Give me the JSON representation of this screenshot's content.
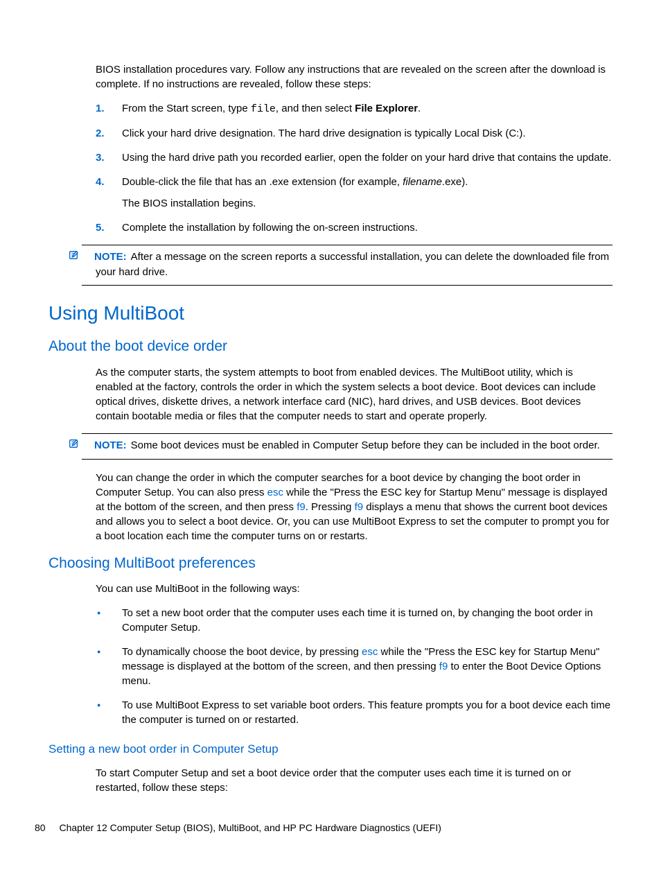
{
  "intro": "BIOS installation procedures vary. Follow any instructions that are revealed on the screen after the download is complete. If no instructions are revealed, follow these steps:",
  "steps": {
    "s1": {
      "num": "1.",
      "pre": "From the Start screen, type ",
      "code": "file",
      "mid": ", and then select ",
      "bold": "File Explorer",
      "post": "."
    },
    "s2": {
      "num": "2.",
      "text": "Click your hard drive designation. The hard drive designation is typically Local Disk (C:)."
    },
    "s3": {
      "num": "3.",
      "text": "Using the hard drive path you recorded earlier, open the folder on your hard drive that contains the update."
    },
    "s4": {
      "num": "4.",
      "pre": "Double-click the file that has an .exe extension (for example, ",
      "italic": "filename",
      "post": ".exe).",
      "sub": "The BIOS installation begins."
    },
    "s5": {
      "num": "5.",
      "text": "Complete the installation by following the on-screen instructions."
    }
  },
  "note1": {
    "label": "NOTE:",
    "text": "After a message on the screen reports a successful installation, you can delete the downloaded file from your hard drive."
  },
  "h1": "Using MultiBoot",
  "h2a": "About the boot device order",
  "para_about": "As the computer starts, the system attempts to boot from enabled devices. The MultiBoot utility, which is enabled at the factory, controls the order in which the system selects a boot device. Boot devices can include optical drives, diskette drives, a network interface card (NIC), hard drives, and USB devices. Boot devices contain bootable media or files that the computer needs to start and operate properly.",
  "note2": {
    "label": "NOTE:",
    "text": "Some boot devices must be enabled in Computer Setup before they can be included in the boot order."
  },
  "para_change": {
    "p1": "You can change the order in which the computer searches for a boot device by changing the boot order in Computer Setup. You can also press ",
    "k1": "esc",
    "p2": " while the \"Press the ESC key for Startup Menu\" message is displayed at the bottom of the screen, and then press ",
    "k2": "f9",
    "p3": ". Pressing ",
    "k3": "f9",
    "p4": " displays a menu that shows the current boot devices and allows you to select a boot device. Or, you can use MultiBoot Express to set the computer to prompt you for a boot location each time the computer turns on or restarts."
  },
  "h2b": "Choosing MultiBoot preferences",
  "para_prefs": "You can use MultiBoot in the following ways:",
  "bullets": {
    "b1": "To set a new boot order that the computer uses each time it is turned on, by changing the boot order in Computer Setup.",
    "b2": {
      "p1": "To dynamically choose the boot device, by pressing ",
      "k1": "esc",
      "p2": " while the \"Press the ESC key for Startup Menu\" message is displayed at the bottom of the screen, and then pressing ",
      "k2": "f9",
      "p3": " to enter the Boot Device Options menu."
    },
    "b3": "To use MultiBoot Express to set variable boot orders. This feature prompts you for a boot device each time the computer is turned on or restarted."
  },
  "h3": "Setting a new boot order in Computer Setup",
  "para_setting": "To start Computer Setup and set a boot device order that the computer uses each time it is turned on or restarted, follow these steps:",
  "footer": {
    "page": "80",
    "chapter": "Chapter 12   Computer Setup (BIOS), MultiBoot, and HP PC Hardware Diagnostics (UEFI)"
  }
}
